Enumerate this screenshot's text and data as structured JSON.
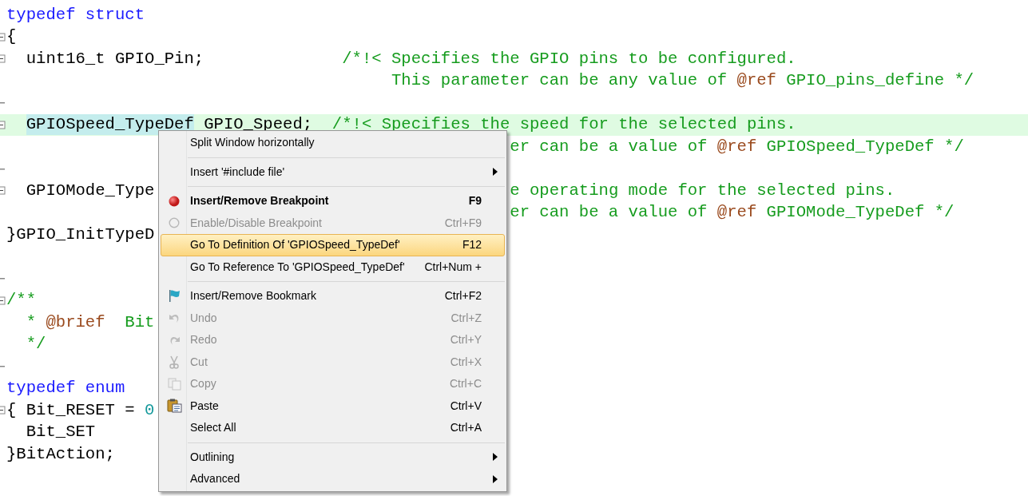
{
  "editor": {
    "lines": [
      {
        "fold_start": false,
        "fold_end": false,
        "current": false,
        "segments": [
          {
            "kind": "keyword",
            "text": "typedef struct"
          }
        ]
      },
      {
        "fold_start": true,
        "fold_end": false,
        "current": false,
        "segments": [
          {
            "kind": "plain",
            "text": "{"
          }
        ]
      },
      {
        "fold_start": true,
        "fold_end": false,
        "current": false,
        "segments": [
          {
            "kind": "plain",
            "text": "  uint16_t GPIO_Pin;              "
          },
          {
            "kind": "comment",
            "text": "/*!< Specifies the GPIO pins to be configured."
          }
        ]
      },
      {
        "fold_start": false,
        "fold_end": false,
        "current": false,
        "segments": [
          {
            "kind": "comment",
            "text": "                                       This parameter can be any value of "
          },
          {
            "kind": "doctag",
            "text": "@ref"
          },
          {
            "kind": "comment",
            "text": " GPIO_pins_define */"
          }
        ]
      },
      {
        "fold_start": false,
        "fold_end": true,
        "current": false
      },
      {
        "fold_start": true,
        "fold_end": false,
        "current": true,
        "segments": [
          {
            "kind": "highlighted",
            "text": "  GPIOSpeed_TypeDef"
          },
          {
            "kind": "plain",
            "text": " GPIO_Speed;  "
          },
          {
            "kind": "comment",
            "text": "/*!< Specifies the speed for the selected pins."
          }
        ]
      },
      {
        "fold_start": false,
        "fold_end": false,
        "current": false,
        "segments": [
          {
            "kind": "comment",
            "text": "                                                   er can be a value of "
          },
          {
            "kind": "doctag",
            "text": "@ref"
          },
          {
            "kind": "comment",
            "text": " GPIOSpeed_TypeDef */"
          }
        ]
      },
      {
        "fold_start": false,
        "fold_end": true,
        "current": false
      },
      {
        "fold_start": true,
        "fold_end": false,
        "current": false,
        "segments": [
          {
            "kind": "plain",
            "text": "  GPIOMode_Type"
          },
          {
            "kind": "comment",
            "text": "                                    e operating mode for the selected pins."
          }
        ]
      },
      {
        "fold_start": false,
        "fold_end": false,
        "current": false,
        "segments": [
          {
            "kind": "comment",
            "text": "                                                   er can be a value of "
          },
          {
            "kind": "doctag",
            "text": "@ref"
          },
          {
            "kind": "comment",
            "text": " GPIOMode_TypeDef */"
          }
        ]
      },
      {
        "fold_start": false,
        "fold_end": false,
        "current": false,
        "segments": [
          {
            "kind": "plain",
            "text": "}GPIO_InitTypeD"
          }
        ]
      },
      {
        "fold_start": false,
        "fold_end": false,
        "current": false
      },
      {
        "fold_start": false,
        "fold_end": true,
        "current": false
      },
      {
        "fold_start": true,
        "fold_end": false,
        "current": false,
        "segments": [
          {
            "kind": "comment",
            "text": "/**"
          }
        ]
      },
      {
        "fold_start": false,
        "fold_end": false,
        "current": false,
        "segments": [
          {
            "kind": "comment",
            "text": "  * "
          },
          {
            "kind": "doctag",
            "text": "@brief"
          },
          {
            "kind": "comment",
            "text": "  Bit"
          }
        ]
      },
      {
        "fold_start": false,
        "fold_end": false,
        "current": false,
        "segments": [
          {
            "kind": "comment",
            "text": "  */"
          }
        ]
      },
      {
        "fold_start": false,
        "fold_end": true,
        "current": false
      },
      {
        "fold_start": false,
        "fold_end": false,
        "current": false,
        "segments": [
          {
            "kind": "keyword",
            "text": "typedef enum"
          }
        ]
      },
      {
        "fold_start": true,
        "fold_end": false,
        "current": false,
        "segments": [
          {
            "kind": "plain",
            "text": "{ Bit_RESET = "
          },
          {
            "kind": "number",
            "text": "0"
          }
        ]
      },
      {
        "fold_start": false,
        "fold_end": false,
        "current": false,
        "segments": [
          {
            "kind": "plain",
            "text": "  Bit_SET"
          }
        ]
      },
      {
        "fold_start": false,
        "fold_end": false,
        "current": false,
        "segments": [
          {
            "kind": "plain",
            "text": "}BitAction;"
          }
        ]
      }
    ]
  },
  "context_menu": {
    "items": [
      {
        "kind": "item",
        "label": "Split Window horizontally",
        "disabled": false,
        "selected": false,
        "default": false,
        "submenu": false
      },
      {
        "kind": "separator"
      },
      {
        "kind": "item",
        "label": "Insert '#include file'",
        "disabled": false,
        "selected": false,
        "default": false,
        "submenu": true
      },
      {
        "kind": "separator"
      },
      {
        "kind": "item",
        "label": "Insert/Remove Breakpoint",
        "shortcut": "F9",
        "disabled": false,
        "selected": false,
        "default": true,
        "submenu": false
      },
      {
        "kind": "item",
        "label": "Enable/Disable Breakpoint",
        "shortcut": "Ctrl+F9",
        "disabled": true,
        "selected": false,
        "default": false,
        "submenu": false
      },
      {
        "kind": "item",
        "label": "Go To Definition Of 'GPIOSpeed_TypeDef'",
        "shortcut": "F12",
        "disabled": false,
        "selected": true,
        "default": false,
        "submenu": false
      },
      {
        "kind": "item",
        "label": "Go To Reference To 'GPIOSpeed_TypeDef'",
        "shortcut": "Ctrl+Num +",
        "disabled": false,
        "selected": false,
        "default": false,
        "submenu": false
      },
      {
        "kind": "separator"
      },
      {
        "kind": "item",
        "label": "Insert/Remove Bookmark",
        "shortcut": "Ctrl+F2",
        "disabled": false,
        "selected": false,
        "default": false,
        "submenu": false
      },
      {
        "kind": "item",
        "label": "Undo",
        "shortcut": "Ctrl+Z",
        "disabled": true,
        "selected": false,
        "default": false,
        "submenu": false
      },
      {
        "kind": "item",
        "label": "Redo",
        "shortcut": "Ctrl+Y",
        "disabled": true,
        "selected": false,
        "default": false,
        "submenu": false
      },
      {
        "kind": "item",
        "label": "Cut",
        "shortcut": "Ctrl+X",
        "disabled": true,
        "selected": false,
        "default": false,
        "submenu": false
      },
      {
        "kind": "item",
        "label": "Copy",
        "shortcut": "Ctrl+C",
        "disabled": true,
        "selected": false,
        "default": false,
        "submenu": false
      },
      {
        "kind": "item",
        "label": "Paste",
        "shortcut": "Ctrl+V",
        "disabled": false,
        "selected": false,
        "default": false,
        "submenu": false
      },
      {
        "kind": "item",
        "label": "Select All",
        "shortcut": "Ctrl+A",
        "disabled": false,
        "selected": false,
        "default": false,
        "submenu": false
      },
      {
        "kind": "separator"
      },
      {
        "kind": "item",
        "label": "Outlining",
        "disabled": false,
        "selected": false,
        "default": false,
        "submenu": true
      },
      {
        "kind": "item",
        "label": "Advanced",
        "disabled": false,
        "selected": false,
        "default": false,
        "submenu": true
      }
    ]
  }
}
